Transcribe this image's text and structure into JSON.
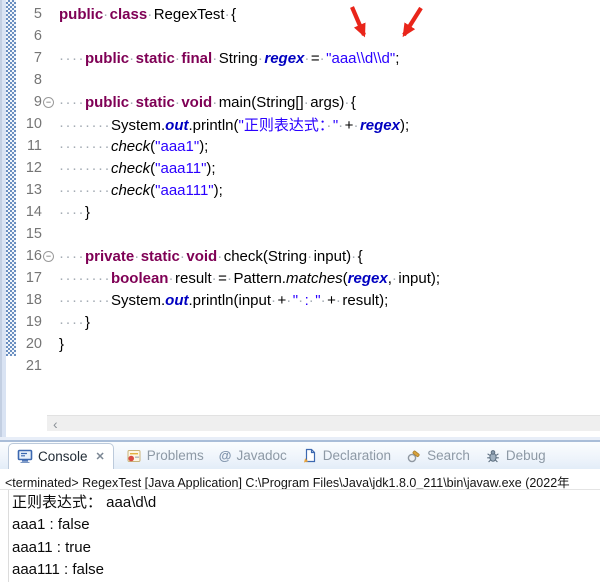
{
  "colors": {
    "keyword": "#7f0055",
    "string": "#2a00ff",
    "constant": "#0000c0",
    "current_line_highlight": "#e8f2fe",
    "arrow": "#e9251a",
    "range_indicator_blue": "#6b8fc0"
  },
  "editor": {
    "current_line": "8",
    "fold_glyph": "−",
    "scroll_left_glyph": "‹",
    "lines": [
      {
        "n": "5",
        "tokens": [
          {
            "t": "public",
            "c": "kw"
          },
          {
            "t": "·",
            "c": "ws"
          },
          {
            "t": "class",
            "c": "kw"
          },
          {
            "t": "·",
            "c": "ws"
          },
          {
            "t": "RegexTest",
            "c": "pl"
          },
          {
            "t": "·",
            "c": "ws"
          },
          {
            "t": "{",
            "c": "pl"
          }
        ]
      },
      {
        "n": "6",
        "tokens": []
      },
      {
        "n": "7",
        "tokens": [
          {
            "t": "····",
            "c": "ws"
          },
          {
            "t": "public",
            "c": "kw"
          },
          {
            "t": "·",
            "c": "ws"
          },
          {
            "t": "static",
            "c": "kw"
          },
          {
            "t": "·",
            "c": "ws"
          },
          {
            "t": "final",
            "c": "kw"
          },
          {
            "t": "·",
            "c": "ws"
          },
          {
            "t": "String",
            "c": "pl"
          },
          {
            "t": "·",
            "c": "ws"
          },
          {
            "t": "regex",
            "c": "cf"
          },
          {
            "t": "·",
            "c": "ws"
          },
          {
            "t": "=",
            "c": "pl"
          },
          {
            "t": "·",
            "c": "ws"
          },
          {
            "t": "\"aaa\\\\d\\\\d\"",
            "c": "str"
          },
          {
            "t": ";",
            "c": "pl"
          }
        ]
      },
      {
        "n": "8",
        "tokens": []
      },
      {
        "n": "9",
        "fold": true,
        "tokens": [
          {
            "t": "····",
            "c": "ws"
          },
          {
            "t": "public",
            "c": "kw"
          },
          {
            "t": "·",
            "c": "ws"
          },
          {
            "t": "static",
            "c": "kw"
          },
          {
            "t": "·",
            "c": "ws"
          },
          {
            "t": "void",
            "c": "kw"
          },
          {
            "t": "·",
            "c": "ws"
          },
          {
            "t": "main(String[]",
            "c": "pl"
          },
          {
            "t": "·",
            "c": "ws"
          },
          {
            "t": "args)",
            "c": "pl"
          },
          {
            "t": "·",
            "c": "ws"
          },
          {
            "t": "{",
            "c": "pl"
          }
        ]
      },
      {
        "n": "10",
        "tokens": [
          {
            "t": "········",
            "c": "ws"
          },
          {
            "t": "System.",
            "c": "pl"
          },
          {
            "t": "out",
            "c": "cf"
          },
          {
            "t": ".println(",
            "c": "pl"
          },
          {
            "t": "\"正则表达式：",
            "c": "str"
          },
          {
            "t": "·",
            "c": "ws"
          },
          {
            "t": "\"",
            "c": "str"
          },
          {
            "t": "·",
            "c": "ws"
          },
          {
            "t": "+",
            "c": "pl"
          },
          {
            "t": "·",
            "c": "ws"
          },
          {
            "t": "regex",
            "c": "cf"
          },
          {
            "t": ");",
            "c": "pl"
          }
        ]
      },
      {
        "n": "11",
        "tokens": [
          {
            "t": "········",
            "c": "ws"
          },
          {
            "t": "check",
            "c": "sm"
          },
          {
            "t": "(",
            "c": "pl"
          },
          {
            "t": "\"aaa1\"",
            "c": "str"
          },
          {
            "t": ");",
            "c": "pl"
          }
        ]
      },
      {
        "n": "12",
        "tokens": [
          {
            "t": "········",
            "c": "ws"
          },
          {
            "t": "check",
            "c": "sm"
          },
          {
            "t": "(",
            "c": "pl"
          },
          {
            "t": "\"aaa11\"",
            "c": "str"
          },
          {
            "t": ");",
            "c": "pl"
          }
        ]
      },
      {
        "n": "13",
        "tokens": [
          {
            "t": "········",
            "c": "ws"
          },
          {
            "t": "check",
            "c": "sm"
          },
          {
            "t": "(",
            "c": "pl"
          },
          {
            "t": "\"aaa111\"",
            "c": "str"
          },
          {
            "t": ");",
            "c": "pl"
          }
        ]
      },
      {
        "n": "14",
        "tokens": [
          {
            "t": "····",
            "c": "ws"
          },
          {
            "t": "}",
            "c": "pl"
          }
        ]
      },
      {
        "n": "15",
        "tokens": []
      },
      {
        "n": "16",
        "fold": true,
        "tokens": [
          {
            "t": "····",
            "c": "ws"
          },
          {
            "t": "private",
            "c": "kw"
          },
          {
            "t": "·",
            "c": "ws"
          },
          {
            "t": "static",
            "c": "kw"
          },
          {
            "t": "·",
            "c": "ws"
          },
          {
            "t": "void",
            "c": "kw"
          },
          {
            "t": "·",
            "c": "ws"
          },
          {
            "t": "check(String",
            "c": "pl"
          },
          {
            "t": "·",
            "c": "ws"
          },
          {
            "t": "input)",
            "c": "pl"
          },
          {
            "t": "·",
            "c": "ws"
          },
          {
            "t": "{",
            "c": "pl"
          }
        ]
      },
      {
        "n": "17",
        "tokens": [
          {
            "t": "········",
            "c": "ws"
          },
          {
            "t": "boolean",
            "c": "kw"
          },
          {
            "t": "·",
            "c": "ws"
          },
          {
            "t": "result",
            "c": "pl"
          },
          {
            "t": "·",
            "c": "ws"
          },
          {
            "t": "=",
            "c": "pl"
          },
          {
            "t": "·",
            "c": "ws"
          },
          {
            "t": "Pattern.",
            "c": "pl"
          },
          {
            "t": "matches",
            "c": "sm"
          },
          {
            "t": "(",
            "c": "pl"
          },
          {
            "t": "regex",
            "c": "cf"
          },
          {
            "t": ",",
            "c": "pl"
          },
          {
            "t": "·",
            "c": "ws"
          },
          {
            "t": "input);",
            "c": "pl"
          }
        ]
      },
      {
        "n": "18",
        "tokens": [
          {
            "t": "········",
            "c": "ws"
          },
          {
            "t": "System.",
            "c": "pl"
          },
          {
            "t": "out",
            "c": "cf"
          },
          {
            "t": ".println(input",
            "c": "pl"
          },
          {
            "t": "·",
            "c": "ws"
          },
          {
            "t": "+",
            "c": "pl"
          },
          {
            "t": "·",
            "c": "ws"
          },
          {
            "t": "\"",
            "c": "str"
          },
          {
            "t": "·",
            "c": "ws"
          },
          {
            "t": ":",
            "c": "str"
          },
          {
            "t": "·",
            "c": "ws"
          },
          {
            "t": "\"",
            "c": "str"
          },
          {
            "t": "·",
            "c": "ws"
          },
          {
            "t": "+",
            "c": "pl"
          },
          {
            "t": "·",
            "c": "ws"
          },
          {
            "t": "result);",
            "c": "pl"
          }
        ]
      },
      {
        "n": "19",
        "tokens": [
          {
            "t": "····",
            "c": "ws"
          },
          {
            "t": "}",
            "c": "pl"
          }
        ]
      },
      {
        "n": "20",
        "tokens": [
          {
            "t": "}",
            "c": "pl"
          }
        ]
      },
      {
        "n": "21",
        "tokens": []
      }
    ]
  },
  "console": {
    "tabs": [
      {
        "label": "Console",
        "icon": "console-icon",
        "active": true,
        "close_glyph": "✕"
      },
      {
        "label": "Problems",
        "icon": "problems-icon"
      },
      {
        "label": "Javadoc",
        "icon": "javadoc-icon"
      },
      {
        "label": "Declaration",
        "icon": "declaration-icon"
      },
      {
        "label": "Search",
        "icon": "search-icon"
      },
      {
        "label": "Debug",
        "icon": "debug-icon"
      }
    ],
    "title": "<terminated> RegexTest [Java Application] C:\\Program Files\\Java\\jdk1.8.0_211\\bin\\javaw.exe (2022年",
    "output": [
      "正则表达式： aaa\\d\\d",
      "aaa1 : false",
      "aaa11 : true",
      "aaa111 : false"
    ]
  }
}
